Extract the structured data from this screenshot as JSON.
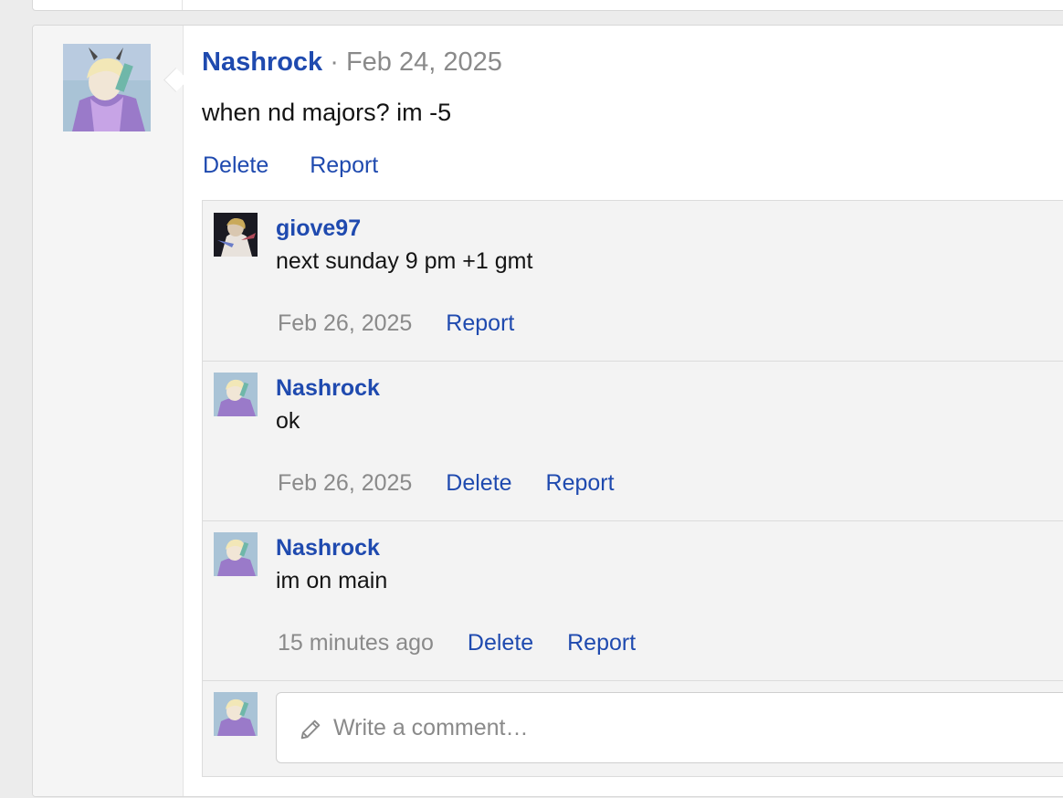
{
  "post": {
    "author": "Nashrock",
    "separator": "·",
    "date": "Feb 24, 2025",
    "body": "when nd majors? im -5",
    "actions": {
      "delete": "Delete",
      "report": "Report"
    }
  },
  "comments": [
    {
      "author": "giove97",
      "text": "next sunday 9 pm +1 gmt",
      "date": "Feb 26, 2025",
      "report": "Report"
    },
    {
      "author": "Nashrock",
      "text": "ok",
      "date": "Feb 26, 2025",
      "delete": "Delete",
      "report": "Report"
    },
    {
      "author": "Nashrock",
      "text": "im on main",
      "date": "15 minutes ago",
      "delete": "Delete",
      "report": "Report"
    }
  ],
  "composer": {
    "placeholder": "Write a comment…",
    "icon": "pencil-icon"
  },
  "colors": {
    "link": "#1f4aaf",
    "muted": "#8a8a8a",
    "comment_bg": "#f3f3f3",
    "page_bg": "#ececec"
  }
}
